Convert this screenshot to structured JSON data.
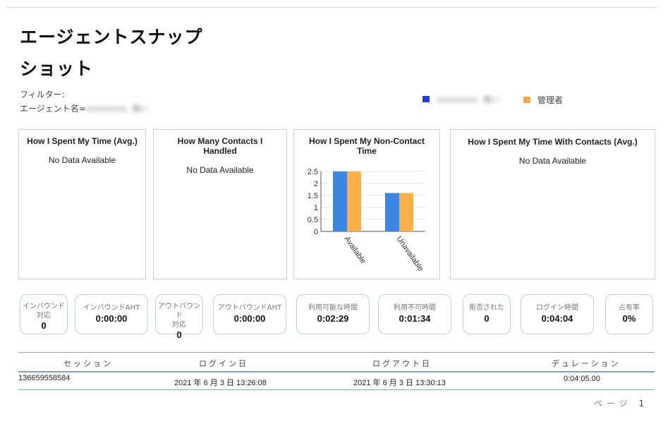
{
  "page": {
    "title_line1": "エージェントスナップ",
    "title_line2": "ショット"
  },
  "filter": {
    "label": "フィルター:",
    "agent_label": "エージェント名=",
    "agent_value": "xxxxxxxx, 浦い"
  },
  "legend": {
    "items": [
      {
        "label": "xxxxxxxx, 浦い",
        "color": "#1a3fe6"
      },
      {
        "label": "管理者",
        "color": "#f9a93b"
      }
    ]
  },
  "panels": [
    {
      "title": "How I Spent My Time (Avg.)",
      "message": "No Data Available"
    },
    {
      "title": "How Many Contacts I Handled",
      "message": "No Data Available"
    },
    {
      "title": "How I Spent My Non-Contact Time"
    },
    {
      "title": "How I Spent My Time With Contacts (Avg.)",
      "message": "No Data Available"
    }
  ],
  "chart_data": {
    "type": "bar",
    "title": "How I Spent My Non-Contact Time",
    "categories": [
      "Available",
      "Unavailable"
    ],
    "series": [
      {
        "color": "#3b87e6",
        "values": [
          2.5,
          1.6
        ]
      },
      {
        "color": "#fbb04a",
        "values": [
          2.5,
          1.6
        ]
      }
    ],
    "yticks": [
      "0",
      "0.5",
      "1",
      "1.5",
      "2",
      "2.5"
    ],
    "ylim": [
      0,
      2.5
    ],
    "grid": true
  },
  "metrics": [
    {
      "label1": "インバウンド",
      "label2": "対応",
      "value": "0"
    },
    {
      "label1": "インバウンドAHT",
      "value": "0:00:00"
    },
    {
      "label1": "アウトバウンド",
      "label2": "対応",
      "value": "0"
    },
    {
      "label1": "アウトバウンドAHT",
      "value": "0:00:00"
    },
    {
      "label1": "利用可能な時間",
      "value": "0:02:29"
    },
    {
      "label1": "利用不可時間",
      "value": "0:01:34"
    },
    {
      "label1": "拒否された",
      "value": "0"
    },
    {
      "label1": "ログイン時間",
      "value": "0:04:04"
    },
    {
      "label1": "占有率",
      "value": "0%"
    }
  ],
  "table": {
    "headers": [
      "セッション",
      "ログイン日",
      "ログアウト日",
      "デュレーション"
    ],
    "rows": [
      [
        "136659558584",
        "2021 年 6 月 3 日 13:26:08",
        "2021 年 6 月 3 日 13:30:13",
        "0:04:05.00"
      ]
    ]
  },
  "pager": {
    "label": "ページ",
    "page": "1"
  }
}
